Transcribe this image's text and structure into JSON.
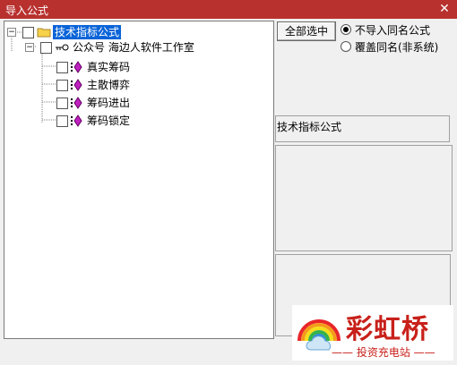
{
  "window": {
    "title": "导入公式",
    "close_glyph": "✕"
  },
  "tree": {
    "root": {
      "label": "技术指标公式",
      "icon": "folder-icon"
    },
    "group": {
      "label": "公众号  海边人软件工作室",
      "icon": "key-icon"
    },
    "items": [
      {
        "label": "真实筹码",
        "icon": "diamond-icon"
      },
      {
        "label": "主散博弈",
        "icon": "diamond-icon"
      },
      {
        "label": "筹码进出",
        "icon": "diamond-icon"
      },
      {
        "label": "筹码锁定",
        "icon": "diamond-icon"
      }
    ]
  },
  "select_all_button": "全部选中",
  "options": {
    "skip_same_name": "不导入同名公式",
    "overwrite_same_name": "覆盖同名(非系统)",
    "selected": "skip_same_name"
  },
  "info_panel": {
    "title": "技术指标公式"
  },
  "watermark": {
    "brand": "彩虹桥",
    "subtitle": "—— 投资充电站 ——"
  }
}
